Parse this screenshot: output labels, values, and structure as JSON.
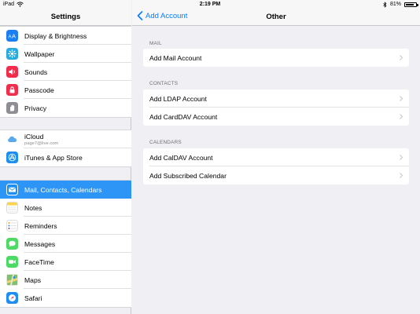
{
  "status_bar": {
    "device": "iPad",
    "time": "2:19 PM",
    "battery": "81%",
    "battery_level": 0.81
  },
  "sidebar": {
    "title": "Settings",
    "groups": [
      [
        {
          "label": "Display & Brightness",
          "icon": "display-brightness-icon",
          "color": "#1a7ef5"
        },
        {
          "label": "Wallpaper",
          "icon": "wallpaper-icon",
          "color": "#27aae1"
        },
        {
          "label": "Sounds",
          "icon": "sounds-icon",
          "color": "#f02e4c"
        },
        {
          "label": "Passcode",
          "icon": "passcode-icon",
          "color": "#f02e4c"
        },
        {
          "label": "Privacy",
          "icon": "privacy-icon",
          "color": "#8e8e93"
        }
      ],
      [
        {
          "label": "iCloud",
          "sublabel": "page7@live.com",
          "icon": "icloud-icon",
          "color": "#ffffff"
        },
        {
          "label": "iTunes & App Store",
          "icon": "app-store-icon",
          "color": "#1e8ef2"
        }
      ],
      [
        {
          "label": "Mail, Contacts, Calendars",
          "icon": "mail-icon",
          "color": "#1e8ef2",
          "selected": true
        },
        {
          "label": "Notes",
          "icon": "notes-icon",
          "color": "#fbd64a"
        },
        {
          "label": "Reminders",
          "icon": "reminders-icon",
          "color": "#ffffff"
        },
        {
          "label": "Messages",
          "icon": "messages-icon",
          "color": "#4cd964"
        },
        {
          "label": "FaceTime",
          "icon": "facetime-icon",
          "color": "#4cd964"
        },
        {
          "label": "Maps",
          "icon": "maps-icon",
          "color": "#7ec36b"
        },
        {
          "label": "Safari",
          "icon": "safari-icon",
          "color": "#1e8ef2"
        }
      ]
    ]
  },
  "detail": {
    "back_label": "Add Account",
    "title": "Other",
    "sections": [
      {
        "header": "MAIL",
        "items": [
          "Add Mail Account"
        ]
      },
      {
        "header": "CONTACTS",
        "items": [
          "Add LDAP Account",
          "Add CardDAV Account"
        ]
      },
      {
        "header": "CALENDARS",
        "items": [
          "Add CalDAV Account",
          "Add Subscribed Calendar"
        ]
      }
    ]
  }
}
